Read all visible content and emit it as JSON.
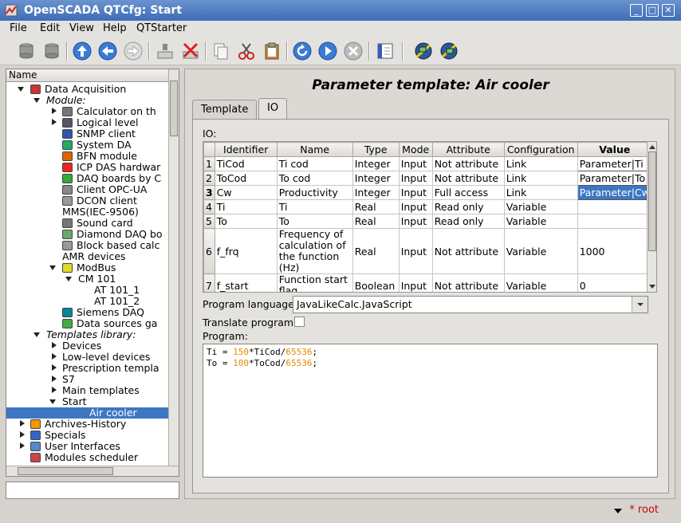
{
  "window": {
    "title": "OpenSCADA QTCfg: Start"
  },
  "menu": [
    "File",
    "Edit",
    "View",
    "Help",
    "QTStarter"
  ],
  "tree": {
    "header": "Name",
    "items": [
      {
        "label": "Data Acquisition"
      },
      {
        "label": "Module:"
      },
      {
        "label": "Calculator on th"
      },
      {
        "label": "Logical level"
      },
      {
        "label": "SNMP client"
      },
      {
        "label": "System DA"
      },
      {
        "label": "BFN module"
      },
      {
        "label": "ICP DAS hardwar"
      },
      {
        "label": "DAQ boards by C"
      },
      {
        "label": "Client OPC-UA"
      },
      {
        "label": "DCON client"
      },
      {
        "label": "MMS(IEC-9506)"
      },
      {
        "label": "Sound card"
      },
      {
        "label": "Diamond DAQ bo"
      },
      {
        "label": "Block based calc"
      },
      {
        "label": "AMR devices"
      },
      {
        "label": "ModBus"
      },
      {
        "label": "CM 101"
      },
      {
        "label": "AT 101_1"
      },
      {
        "label": "AT 101_2"
      },
      {
        "label": "Siemens DAQ"
      },
      {
        "label": "Data sources ga"
      },
      {
        "label": "Templates library:"
      },
      {
        "label": "Devices"
      },
      {
        "label": "Low-level devices"
      },
      {
        "label": "Prescription templa"
      },
      {
        "label": "S7"
      },
      {
        "label": "Main templates"
      },
      {
        "label": "Start"
      },
      {
        "label": "Air cooler"
      },
      {
        "label": "Archives-History"
      },
      {
        "label": "Specials"
      },
      {
        "label": "User Interfaces"
      },
      {
        "label": "Modules scheduler"
      }
    ]
  },
  "panel": {
    "title": "Parameter template: Air cooler",
    "tabs": [
      "Template",
      "IO"
    ],
    "io_label": "IO:",
    "columns": [
      "Identifier",
      "Name",
      "Type",
      "Mode",
      "Attribute",
      "Configuration",
      "Value"
    ],
    "rows": [
      {
        "n": "1",
        "id": "TiCod",
        "name": "Ti cod",
        "type": "Integer",
        "mode": "Input",
        "attr": "Not attribute",
        "conf": "Link",
        "value": "Parameter|Ti"
      },
      {
        "n": "2",
        "id": "ToCod",
        "name": "To cod",
        "type": "Integer",
        "mode": "Input",
        "attr": "Not attribute",
        "conf": "Link",
        "value": "Parameter|To"
      },
      {
        "n": "3",
        "id": "Cw",
        "name": "Productivity",
        "type": "Integer",
        "mode": "Input",
        "attr": "Full access",
        "conf": "Link",
        "value": "Parameter|Cw"
      },
      {
        "n": "4",
        "id": "Ti",
        "name": "Ti",
        "type": "Real",
        "mode": "Input",
        "attr": "Read only",
        "conf": "Variable",
        "value": ""
      },
      {
        "n": "5",
        "id": "To",
        "name": "To",
        "type": "Real",
        "mode": "Input",
        "attr": "Read only",
        "conf": "Variable",
        "value": ""
      },
      {
        "n": "6",
        "id": "f_frq",
        "name": "Frequency of calculation of the function (Hz)",
        "type": "Real",
        "mode": "Input",
        "attr": "Not attribute",
        "conf": "Variable",
        "value": "1000"
      },
      {
        "n": "7",
        "id": "f_start",
        "name": "Function start flag",
        "type": "Boolean",
        "mode": "Input",
        "attr": "Not attribute",
        "conf": "Variable",
        "value": "0"
      }
    ],
    "program_language_label": "Program language:",
    "program_language": "JavaLikeCalc.JavaScript",
    "translate_label": "Translate program:",
    "program_label": "Program:",
    "code": {
      "l1a": "Ti = ",
      "l1n1": "150",
      "l1b": "*TiCod/",
      "l1n2": "65536",
      "l1c": ";",
      "l2a": "To = ",
      "l2n1": "100",
      "l2b": "*ToCod/",
      "l2n2": "65536",
      "l2c": ";"
    }
  },
  "status": {
    "user": "* root"
  },
  "colors": {
    "selection": "#3d77c2",
    "title": "#3d6db7",
    "status_user": "#cc0000",
    "code_number": "#e68a00"
  }
}
